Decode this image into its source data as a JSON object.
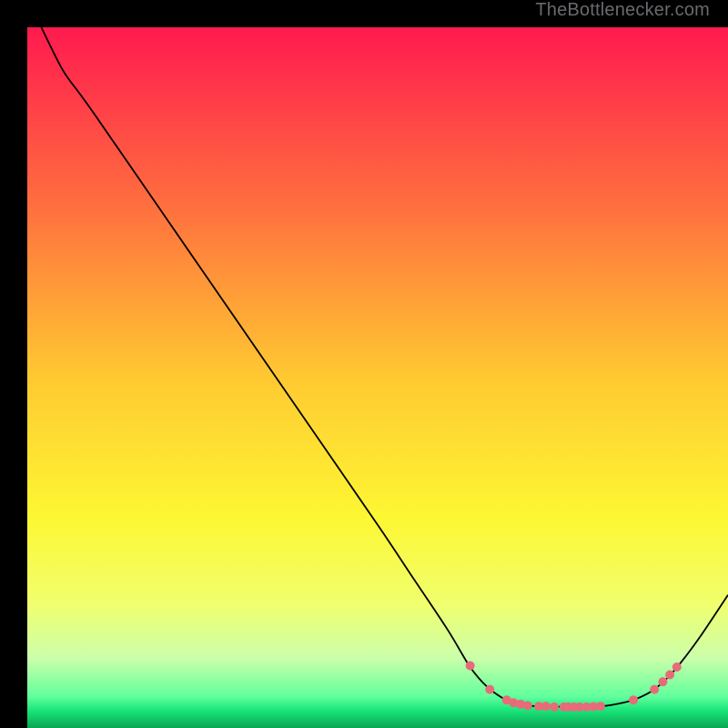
{
  "watermark": "TheBottlenecker.com",
  "chart_data": {
    "type": "line",
    "title": "",
    "xlabel": "",
    "ylabel": "",
    "xlim": [
      0,
      100
    ],
    "ylim": [
      0,
      100
    ],
    "background_gradient": {
      "stops": [
        {
          "offset": 0.0,
          "color": "#ff1a4f"
        },
        {
          "offset": 0.25,
          "color": "#ff6d3f"
        },
        {
          "offset": 0.5,
          "color": "#ffc931"
        },
        {
          "offset": 0.7,
          "color": "#fdf733"
        },
        {
          "offset": 0.82,
          "color": "#f1ff6c"
        },
        {
          "offset": 0.9,
          "color": "#ccffaa"
        },
        {
          "offset": 0.955,
          "color": "#61ff9c"
        },
        {
          "offset": 0.975,
          "color": "#19e57a"
        },
        {
          "offset": 1.0,
          "color": "#0aa653"
        }
      ]
    },
    "series": [
      {
        "name": "bottleneck-curve",
        "color": "#000000",
        "width": 1.8,
        "points": [
          {
            "x": 2.0,
            "y": 100.0
          },
          {
            "x": 5.0,
            "y": 94.0
          },
          {
            "x": 7.5,
            "y": 90.5
          },
          {
            "x": 10.0,
            "y": 87.0
          },
          {
            "x": 20.0,
            "y": 72.5
          },
          {
            "x": 30.0,
            "y": 58.0
          },
          {
            "x": 40.0,
            "y": 43.5
          },
          {
            "x": 50.0,
            "y": 29.0
          },
          {
            "x": 55.0,
            "y": 21.5
          },
          {
            "x": 60.0,
            "y": 14.0
          },
          {
            "x": 63.0,
            "y": 9.0
          },
          {
            "x": 65.0,
            "y": 6.5
          },
          {
            "x": 67.0,
            "y": 4.8
          },
          {
            "x": 69.0,
            "y": 3.7
          },
          {
            "x": 71.0,
            "y": 3.2
          },
          {
            "x": 74.0,
            "y": 3.1
          },
          {
            "x": 78.0,
            "y": 3.0
          },
          {
            "x": 82.0,
            "y": 3.1
          },
          {
            "x": 85.0,
            "y": 3.6
          },
          {
            "x": 87.0,
            "y": 4.2
          },
          {
            "x": 89.0,
            "y": 5.2
          },
          {
            "x": 91.0,
            "y": 6.8
          },
          {
            "x": 93.0,
            "y": 9.0
          },
          {
            "x": 96.0,
            "y": 13.0
          },
          {
            "x": 100.0,
            "y": 19.0
          }
        ]
      }
    ],
    "markers": {
      "color": "#e76b78",
      "radius": 5,
      "points": [
        {
          "x": 63.2,
          "y": 8.9
        },
        {
          "x": 66.0,
          "y": 5.5
        },
        {
          "x": 68.4,
          "y": 4.0
        },
        {
          "x": 69.4,
          "y": 3.6
        },
        {
          "x": 70.4,
          "y": 3.4
        },
        {
          "x": 71.4,
          "y": 3.2
        },
        {
          "x": 73.0,
          "y": 3.1
        },
        {
          "x": 74.0,
          "y": 3.1
        },
        {
          "x": 75.2,
          "y": 3.0
        },
        {
          "x": 76.6,
          "y": 3.0
        },
        {
          "x": 77.2,
          "y": 3.0
        },
        {
          "x": 78.0,
          "y": 3.0
        },
        {
          "x": 78.8,
          "y": 3.0
        },
        {
          "x": 79.8,
          "y": 3.0
        },
        {
          "x": 80.8,
          "y": 3.05
        },
        {
          "x": 81.8,
          "y": 3.1
        },
        {
          "x": 86.5,
          "y": 4.0
        },
        {
          "x": 89.5,
          "y": 5.5
        },
        {
          "x": 90.7,
          "y": 6.6
        },
        {
          "x": 91.7,
          "y": 7.6
        },
        {
          "x": 92.7,
          "y": 8.7
        }
      ]
    }
  }
}
